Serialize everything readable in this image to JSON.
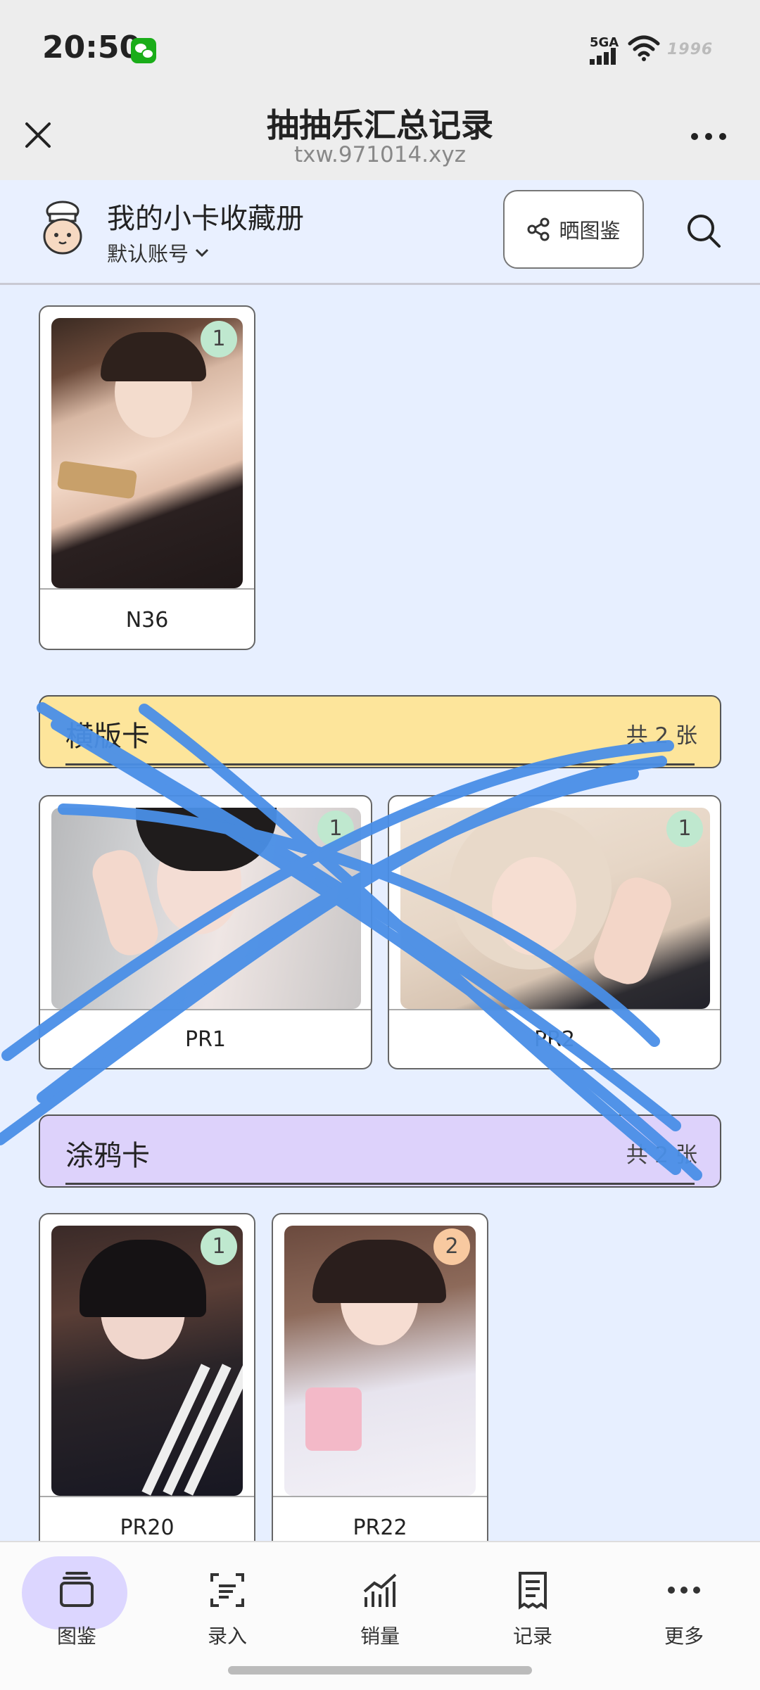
{
  "status_bar": {
    "time": "20:50",
    "network": "5GA",
    "battery_text": "1996"
  },
  "title_bar": {
    "title": "抽抽乐汇总记录",
    "url": "txw.971014.xyz"
  },
  "header": {
    "album_title": "我的小卡收藏册",
    "account": "默认账号",
    "share_label": "晒图鉴"
  },
  "sections": [
    {
      "name": "",
      "cards": [
        {
          "label": "N36",
          "count": "1"
        }
      ]
    },
    {
      "name": "横版卡",
      "total": "共 2 张",
      "bar_color": "#fde59b",
      "cards": [
        {
          "label": "PR1",
          "count": "1"
        },
        {
          "label": "PR2",
          "count": "1"
        }
      ]
    },
    {
      "name": "涂鸦卡",
      "total": "共 2 张",
      "bar_color": "#ddd2fb",
      "cards": [
        {
          "label": "PR20",
          "count": "1"
        },
        {
          "label": "PR22",
          "count": "2"
        }
      ]
    }
  ],
  "tabs": [
    {
      "label": "图鉴",
      "icon": "album-icon",
      "active": true
    },
    {
      "label": "录入",
      "icon": "scan-icon"
    },
    {
      "label": "销量",
      "icon": "chart-icon"
    },
    {
      "label": "记录",
      "icon": "receipt-icon"
    },
    {
      "label": "更多",
      "icon": "more-icon"
    }
  ],
  "colors": {
    "accent": "#dcd6ff",
    "scribble": "#4a8fe7",
    "badge_green": "#bfe8cf",
    "badge_orange": "#f8c9a0"
  }
}
